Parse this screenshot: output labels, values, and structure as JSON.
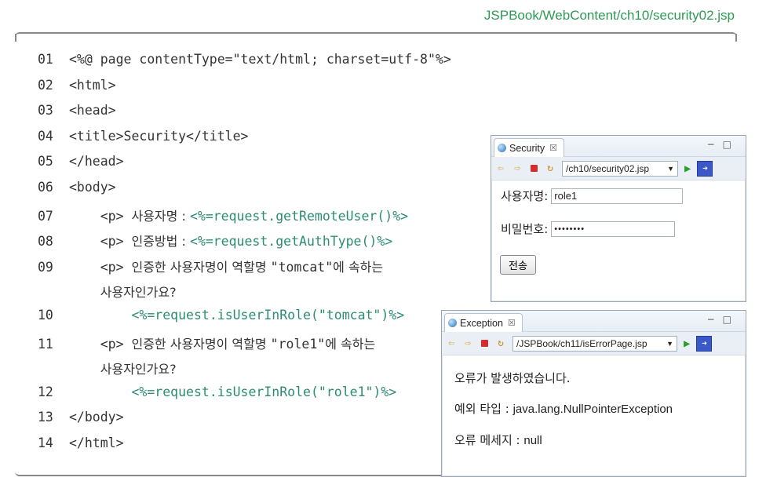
{
  "file_path": "JSPBook/WebContent/ch10/security02.jsp",
  "code_lines": [
    {
      "no": "01",
      "parts": [
        {
          "t": "tag",
          "v": "<%@ page contentType=\"text/html; charset=utf-8\"%>"
        }
      ]
    },
    {
      "no": "02",
      "parts": [
        {
          "t": "tag",
          "v": "<html>"
        }
      ]
    },
    {
      "no": "03",
      "parts": [
        {
          "t": "tag",
          "v": "<head>"
        }
      ]
    },
    {
      "no": "04",
      "parts": [
        {
          "t": "tag",
          "v": "<title>Security</title>"
        }
      ]
    },
    {
      "no": "05",
      "parts": [
        {
          "t": "tag",
          "v": "</head>"
        }
      ]
    },
    {
      "no": "06",
      "parts": [
        {
          "t": "tag",
          "v": "<body>"
        }
      ]
    },
    {
      "no": "07",
      "parts": [
        {
          "t": "tag",
          "v": "    <p> "
        },
        {
          "t": "kr",
          "v": "사용자명 : "
        },
        {
          "t": "exp",
          "v": "<%=request.getRemoteUser()%>"
        }
      ]
    },
    {
      "no": "08",
      "parts": [
        {
          "t": "tag",
          "v": "    <p> "
        },
        {
          "t": "kr",
          "v": "인증방법 : "
        },
        {
          "t": "exp",
          "v": "<%=request.getAuthType()%>"
        }
      ]
    },
    {
      "no": "09",
      "parts": [
        {
          "t": "tag",
          "v": "    <p> "
        },
        {
          "t": "kr",
          "v": "인증한 사용자명이 역할명 "
        },
        {
          "t": "tag",
          "v": "\"tomcat\""
        },
        {
          "t": "kr",
          "v": "에 속하는"
        }
      ]
    },
    {
      "no": "",
      "parts": [
        {
          "t": "tag",
          "v": "    "
        },
        {
          "t": "kr",
          "v": "사용자인가요?"
        }
      ]
    },
    {
      "no": "10",
      "parts": [
        {
          "t": "tag",
          "v": "        "
        },
        {
          "t": "exp",
          "v": "<%=request.isUserInRole(\"tomcat\")%>"
        }
      ]
    },
    {
      "no": "11",
      "parts": [
        {
          "t": "tag",
          "v": "    <p> "
        },
        {
          "t": "kr",
          "v": "인증한 사용자명이 역할명 "
        },
        {
          "t": "tag",
          "v": "\"role1\""
        },
        {
          "t": "kr",
          "v": "에 속하는"
        }
      ]
    },
    {
      "no": "",
      "parts": [
        {
          "t": "tag",
          "v": "    "
        },
        {
          "t": "kr",
          "v": "사용자인가요?"
        }
      ]
    },
    {
      "no": "12",
      "parts": [
        {
          "t": "tag",
          "v": "        "
        },
        {
          "t": "exp",
          "v": "<%=request.isUserInRole(\"role1\")%>"
        }
      ]
    },
    {
      "no": "13",
      "parts": [
        {
          "t": "tag",
          "v": "</body>"
        }
      ]
    },
    {
      "no": "14",
      "parts": [
        {
          "t": "tag",
          "v": "</html>"
        }
      ]
    }
  ],
  "security_window": {
    "tab_title": "Security",
    "tab_close": "☒",
    "url": "/ch10/security02.jsp",
    "username_label": "사용자명:",
    "username_value": "role1",
    "password_label": "비밀번호:",
    "password_value": "••••••••",
    "submit_label": "전송"
  },
  "exception_window": {
    "tab_title": "Exception",
    "tab_close": "☒",
    "url": "/JSPBook/ch11/isErrorPage.jsp",
    "message": "오류가 발생하였습니다.",
    "exception_label": "예외 타입 : ",
    "exception_value": "java.lang.NullPointerException",
    "error_label": "오류 메세지 : ",
    "error_value": "null"
  },
  "icons": {
    "back": "back-arrow-icon",
    "forward": "forward-arrow-icon",
    "stop": "stop-icon",
    "refresh": "refresh-icon",
    "go": "go-icon",
    "minimize": "minimize-icon",
    "maximize": "maximize-icon"
  },
  "colors": {
    "path": "#2f9a57",
    "expression": "#2c8c72"
  }
}
